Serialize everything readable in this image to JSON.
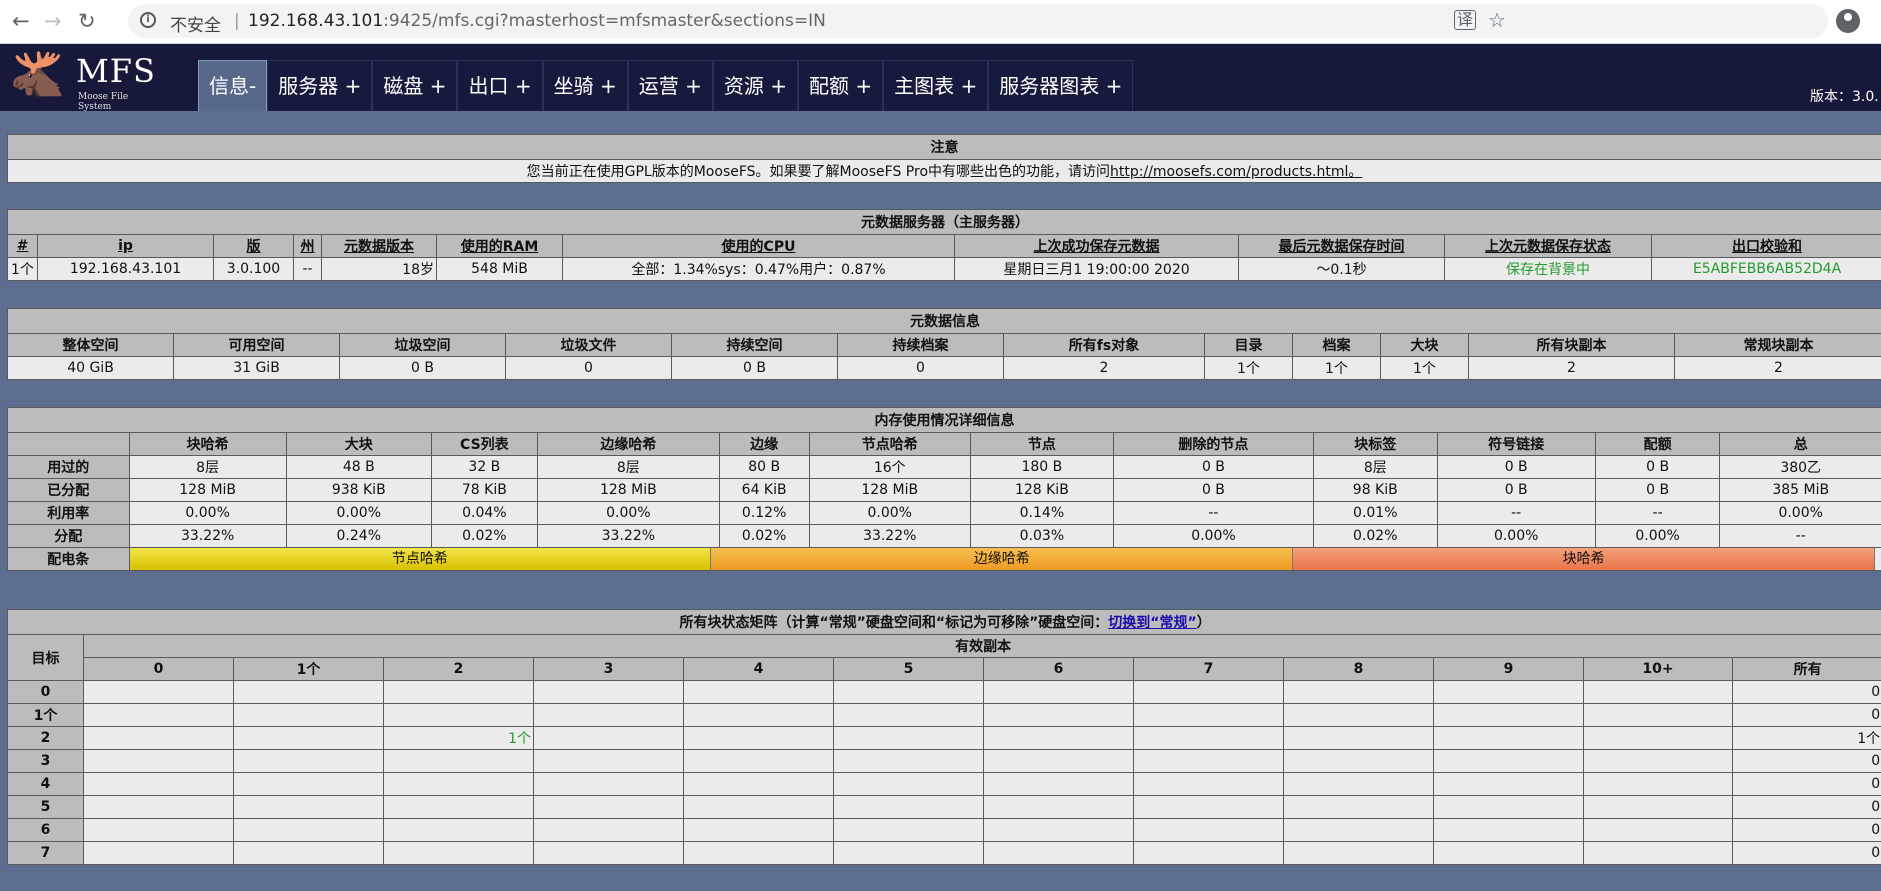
{
  "browser": {
    "back": "←",
    "forward": "→",
    "reload": "↻",
    "insecure": "不安全",
    "url_host": "192.168.43.101",
    "url_rest": ":9425/mfs.cgi?masterhost=mfsmaster&sections=IN",
    "translate": "译",
    "star": "☆"
  },
  "header": {
    "logo_text": "MFS",
    "logo_sub": "Moose File System",
    "version": "版本：3.0.",
    "tabs": [
      {
        "label": "信息-"
      },
      {
        "label": "服务器 +"
      },
      {
        "label": "磁盘 +"
      },
      {
        "label": "出口 +"
      },
      {
        "label": "坐骑 +"
      },
      {
        "label": "运营 +"
      },
      {
        "label": "资源 +"
      },
      {
        "label": "配额 +"
      },
      {
        "label": "主图表 +"
      },
      {
        "label": "服务器图表 +"
      }
    ]
  },
  "notice": {
    "title": "注意",
    "text": "您当前正在使用GPL版本的MooseFS。如果要了解MooseFS Pro中有哪些出色的功能，请访问",
    "link": "http://moosefs.com/products.html。"
  },
  "master": {
    "title": "元数据服务器（主服务器）",
    "headers": [
      "#",
      "ip",
      "版",
      "州",
      "元数据版本",
      "使用的RAM",
      "使用的CPU",
      "上次成功保存元数据",
      "最后元数据保存时间",
      "上次元数据保存状态",
      "出口校验和"
    ],
    "row": [
      "1个",
      "192.168.43.101",
      "3.0.100",
      "--",
      "18岁",
      "548 MiB",
      "全部：1.34%sys：0.47%用户：0.87%",
      "星期日三月1 19:00:00 2020",
      "〜0.1秒",
      "保存在背景中",
      "E5ABFEBB6AB52D4A"
    ]
  },
  "metainfo": {
    "title": "元数据信息",
    "headers": [
      "整体空间",
      "可用空间",
      "垃圾空间",
      "垃圾文件",
      "持续空间",
      "持续档案",
      "所有fs对象",
      "目录",
      "档案",
      "大块",
      "所有块副本",
      "常规块副本"
    ],
    "row": [
      "40 GiB",
      "31 GiB",
      "0 B",
      "0",
      "0 B",
      "0",
      "2",
      "1个",
      "1个",
      "1个",
      "2",
      "2"
    ]
  },
  "memory": {
    "title": "内存使用情况详细信息",
    "headers": [
      "",
      "块哈希",
      "大块",
      "CS列表",
      "边缘哈希",
      "边缘",
      "节点哈希",
      "节点",
      "删除的节点",
      "块标签",
      "符号链接",
      "配额",
      "总"
    ],
    "rows": [
      [
        "用过的",
        "8层",
        "48 B",
        "32 B",
        "8层",
        "80 B",
        "16个",
        "180 B",
        "0 B",
        "8层",
        "0 B",
        "0 B",
        "380乙"
      ],
      [
        "已分配",
        "128 MiB",
        "938 KiB",
        "78 KiB",
        "128 MiB",
        "64 KiB",
        "128 MiB",
        "128 KiB",
        "0 B",
        "98 KiB",
        "0 B",
        "0 B",
        "385 MiB"
      ],
      [
        "利用率",
        "0.00%",
        "0.00%",
        "0.04%",
        "0.00%",
        "0.12%",
        "0.00%",
        "0.14%",
        "--",
        "0.01%",
        "--",
        "--",
        "0.00%"
      ],
      [
        "分配",
        "33.22%",
        "0.24%",
        "0.02%",
        "33.22%",
        "0.02%",
        "33.22%",
        "0.03%",
        "0.00%",
        "0.02%",
        "0.00%",
        "0.00%",
        "--"
      ]
    ],
    "bar_label": "配电条",
    "bar": [
      {
        "label": "节点哈希",
        "share": 0.3322
      },
      {
        "label": "边缘哈希",
        "share": 0.3322
      },
      {
        "label": "块哈希",
        "share": 0.3322
      }
    ]
  },
  "matrix": {
    "title_pre": "所有块状态矩阵（计算“常规”硬盘空间和“标记为可移除”硬盘空间：",
    "title_link": "切换到“常规”",
    "title_post": "）",
    "goal": "目标",
    "valid_copies": "有效副本",
    "cols": [
      "0",
      "1个",
      "2",
      "3",
      "4",
      "5",
      "6",
      "7",
      "8",
      "9",
      "10+",
      "所有"
    ],
    "rows": [
      {
        "label": "0",
        "cells": [
          "",
          "",
          "",
          "",
          "",
          "",
          "",
          "",
          "",
          "",
          "",
          "0"
        ]
      },
      {
        "label": "1个",
        "cells": [
          "",
          "",
          "",
          "",
          "",
          "",
          "",
          "",
          "",
          "",
          "",
          "0"
        ]
      },
      {
        "label": "2",
        "cells": [
          "",
          "",
          "1个",
          "",
          "",
          "",
          "",
          "",
          "",
          "",
          "",
          "1个"
        ]
      },
      {
        "label": "3",
        "cells": [
          "",
          "",
          "",
          "",
          "",
          "",
          "",
          "",
          "",
          "",
          "",
          "0"
        ]
      },
      {
        "label": "4",
        "cells": [
          "",
          "",
          "",
          "",
          "",
          "",
          "",
          "",
          "",
          "",
          "",
          "0"
        ]
      },
      {
        "label": "5",
        "cells": [
          "",
          "",
          "",
          "",
          "",
          "",
          "",
          "",
          "",
          "",
          "",
          "0"
        ]
      },
      {
        "label": "6",
        "cells": [
          "",
          "",
          "",
          "",
          "",
          "",
          "",
          "",
          "",
          "",
          "",
          "0"
        ]
      },
      {
        "label": "7",
        "cells": [
          "",
          "",
          "",
          "",
          "",
          "",
          "",
          "",
          "",
          "",
          "",
          "0"
        ]
      }
    ]
  },
  "colors": {
    "header_bg": "#17193a",
    "page_bg": "#5d6e90",
    "green": "#249a2e"
  }
}
